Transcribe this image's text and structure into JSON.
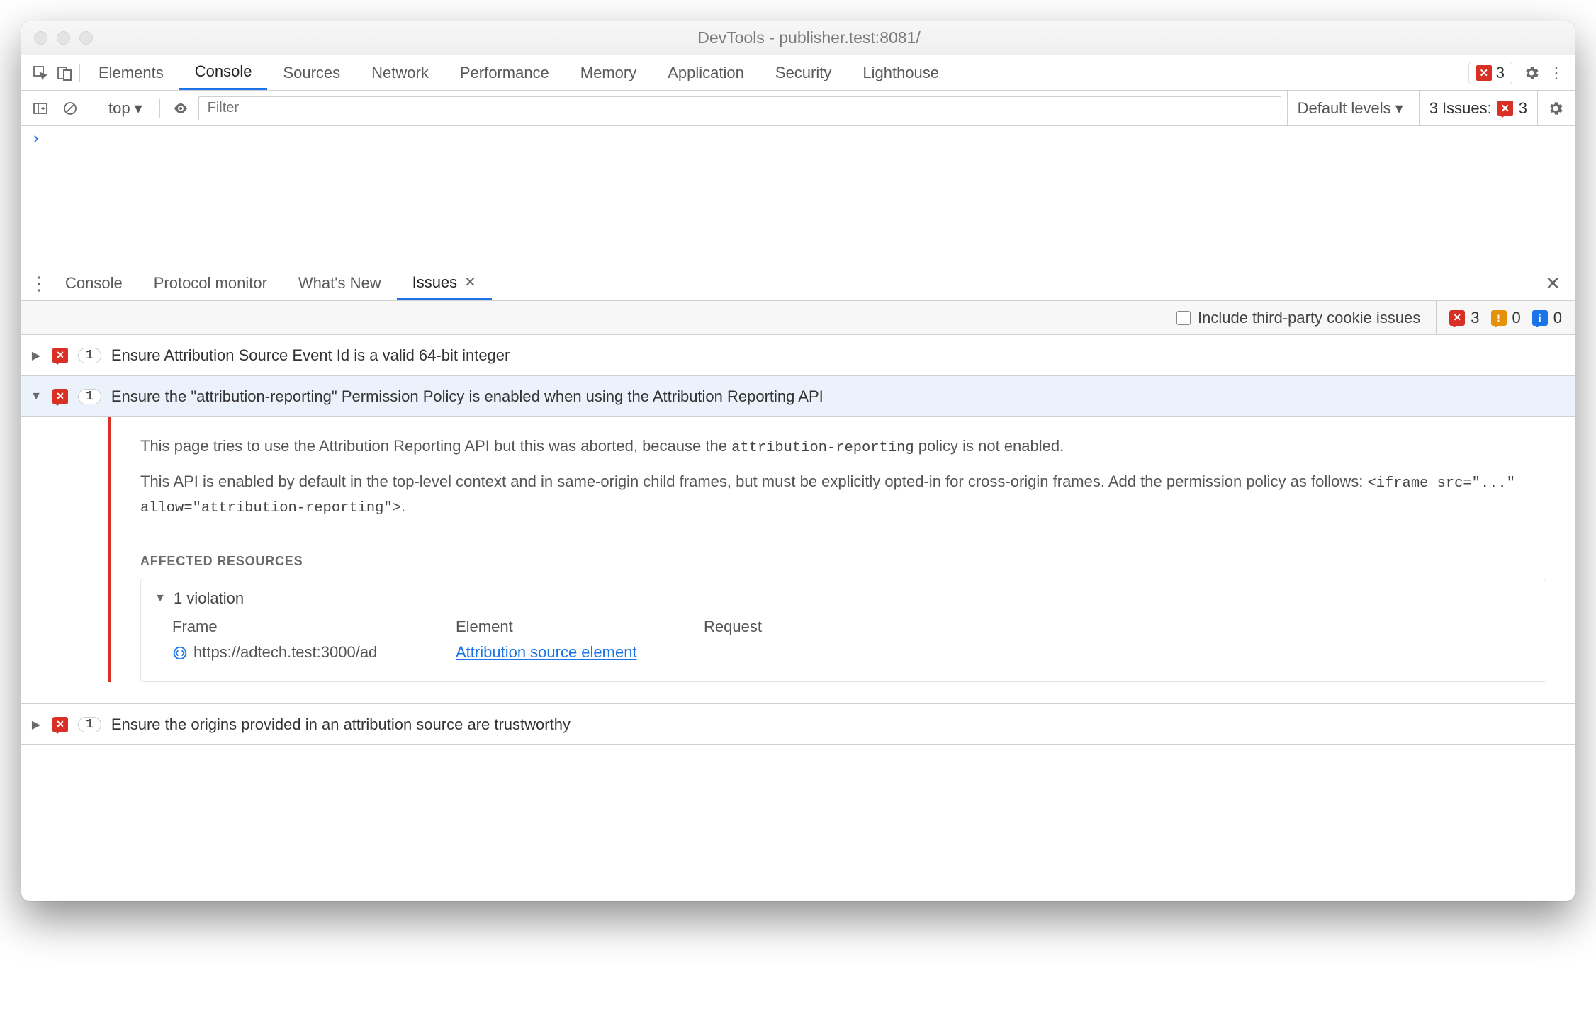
{
  "window": {
    "title": "DevTools - publisher.test:8081/"
  },
  "mainTabs": {
    "items": [
      "Elements",
      "Console",
      "Sources",
      "Network",
      "Performance",
      "Memory",
      "Application",
      "Security",
      "Lighthouse"
    ],
    "active": "Console"
  },
  "topErrors": {
    "count": "3"
  },
  "consoleToolbar": {
    "context": "top",
    "filterPlaceholder": "Filter",
    "levelsLabel": "Default levels",
    "issuesLabel": "3 Issues:",
    "issuesCount": "3"
  },
  "drawerTabs": {
    "items": [
      "Console",
      "Protocol monitor",
      "What's New",
      "Issues"
    ],
    "active": "Issues"
  },
  "issuesFilter": {
    "thirdPartyLabel": "Include third-party cookie issues",
    "counts": {
      "breaking": "3",
      "improvements": "0",
      "info": "0"
    }
  },
  "issues": [
    {
      "count": "1",
      "title": "Ensure Attribution Source Event Id is a valid 64-bit integer",
      "expanded": false
    },
    {
      "count": "1",
      "title": "Ensure the \"attribution-reporting\" Permission Policy is enabled when using the Attribution Reporting API",
      "expanded": true
    },
    {
      "count": "1",
      "title": "Ensure the origins provided in an attribution source are trustworthy",
      "expanded": false
    }
  ],
  "expandedIssue": {
    "para1_a": "This page tries to use the Attribution Reporting API but this was aborted, because the ",
    "para1_code": "attribution-reporting",
    "para1_b": " policy is not enabled.",
    "para2_a": "This API is enabled by default in the top-level context and in same-origin child frames, but must be explicitly opted-in for cross-origin frames. Add the permission policy as follows: ",
    "para2_code": "<iframe src=\"...\" allow=\"attribution-reporting\">",
    "para2_b": ".",
    "affectedHeading": "AFFECTED RESOURCES",
    "violationsLabel": "1 violation",
    "columns": {
      "frame": "Frame",
      "element": "Element",
      "request": "Request"
    },
    "row": {
      "frame": "https://adtech.test:3000/ad",
      "element": "Attribution source element",
      "request": ""
    }
  }
}
